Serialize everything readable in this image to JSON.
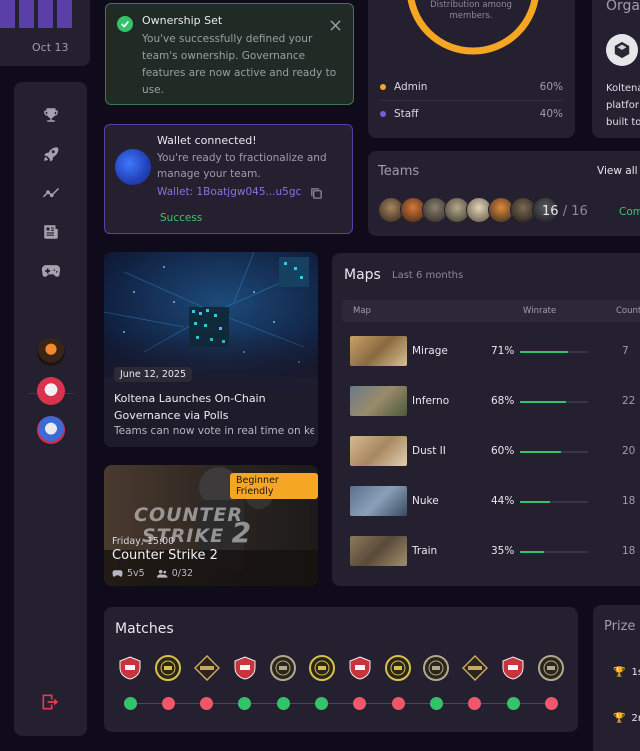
{
  "chart_fragment": {
    "date": "Oct 13"
  },
  "toast_ownership": {
    "title": "Ownership Set",
    "body": "You've successfully defined your team's ownership. Governance features are now active and ready to use."
  },
  "toast_wallet": {
    "title": "Wallet connected!",
    "body": "You're ready to fractionalize and manage your team.",
    "address": "Wallet: 1Boatjgw045...u5gc",
    "status": "Success"
  },
  "distribution": {
    "ring_label": "Distribution among members.",
    "items": [
      {
        "label": "Admin",
        "value": "60%",
        "color": "#f5a623"
      },
      {
        "label": "Staff",
        "value": "40%",
        "color": "#7b5cd6"
      }
    ]
  },
  "org": {
    "title": "Orga",
    "text": [
      "Koltena",
      "platfor",
      "built to"
    ]
  },
  "teams": {
    "title": "Teams",
    "view_all": "View all",
    "count": "16",
    "total": "16",
    "sep": "/",
    "right_label": "Com"
  },
  "news": {
    "date": "June 12, 2025",
    "title": "Koltena Launches On-Chain Governance via Polls",
    "subtitle": "Teams can now vote in real time on ke..."
  },
  "event": {
    "badge": "Beginner Friendly",
    "logo_line1": "COUNTER",
    "logo_line2": "STRIKE",
    "logo_num": "2",
    "time": "Friday, 15:00",
    "name": "Counter Strike 2",
    "format": "5v5",
    "slots": "0/32"
  },
  "maps": {
    "title": "Maps",
    "period": "Last 6 months",
    "columns": [
      "Map",
      "Winrate",
      "Count"
    ],
    "rows": [
      {
        "name": "Mirage",
        "winrate": "71%",
        "rate": 0.71,
        "count": "7"
      },
      {
        "name": "Inferno",
        "winrate": "68%",
        "rate": 0.68,
        "count": "22"
      },
      {
        "name": "Dust II",
        "winrate": "60%",
        "rate": 0.6,
        "count": "20"
      },
      {
        "name": "Nuke",
        "winrate": "44%",
        "rate": 0.44,
        "count": "18"
      },
      {
        "name": "Train",
        "winrate": "35%",
        "rate": 0.35,
        "count": "18"
      }
    ]
  },
  "matches": {
    "title": "Matches",
    "results": [
      "win",
      "loss",
      "loss",
      "win",
      "win",
      "win",
      "loss",
      "loss",
      "win",
      "loss",
      "win",
      "loss"
    ],
    "colors": {
      "win": "#34c26a",
      "loss": "#f0576b"
    }
  },
  "prize": {
    "title": "Prize",
    "places": [
      "1s",
      "2r"
    ]
  }
}
